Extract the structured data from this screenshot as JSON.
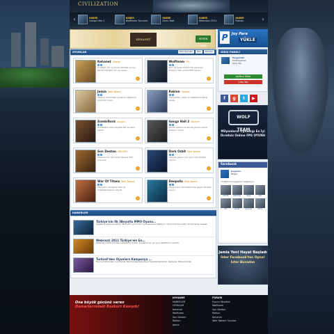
{
  "header": {
    "logo": "CIVILIZATION",
    "strip": [
      {
        "tag": "HABER",
        "text": "Gangz Hali 2"
      },
      {
        "tag": "HABER",
        "text": "Wolfteam Turnuva"
      },
      {
        "tag": "HABER",
        "text": "Zorlu Bati"
      },
      {
        "tag": "HABER",
        "text": "Webrazzi 2011"
      },
      {
        "tag": "HABER",
        "text": "Rakion"
      }
    ]
  },
  "banner": {
    "center": "KEHANET",
    "button": "HEMEN OYNA"
  },
  "games_section": {
    "title": "OYUNLAR",
    "tabs": [
      "Tüm Oyunlar",
      "Yeni",
      "Popüler"
    ]
  },
  "games": [
    {
      "title": "Kehanet",
      "genre": "Strateji",
      "desc": "Ücretsiz çok oyunculu strateji oyunu. Kendi krallığını kur ve savaş.",
      "color1": "#c9a25a",
      "color2": "#6b4a22"
    },
    {
      "title": "Wolfteam",
      "genre": "FPS",
      "desc": "Kurt ve insan formunda oynanan aksiyon dolu online FPS oyunu.",
      "color1": "#3a4a5c",
      "color2": "#121a24"
    },
    {
      "title": "Jamia",
      "genre": "Web Tabanlı",
      "desc": "Tarayıcı üzerinden oynanan eğlenceli çevrimiçi oyun.",
      "color1": "#d9c8a0",
      "color2": "#8a6a3c"
    },
    {
      "title": "Rakion",
      "genre": "Aksiyon",
      "desc": "Canavarları çağır ve rakiplerine karşı savaş.",
      "color1": "#8aa0c0",
      "color2": "#2a3a58"
    },
    {
      "title": "ZombiRock",
      "genre": "Aksiyon",
      "desc": "Zombilere karşı hayatta kal ve şehri kurtar.",
      "color1": "#7a5030",
      "color2": "#2a1a10"
    },
    {
      "title": "Gangz Hali 2",
      "genre": "Aksiyon",
      "desc": "Sokak çeteleri arasında geçen online aksiyon oyunu.",
      "color1": "#5a5a5a",
      "color2": "#1c1c1c"
    },
    {
      "title": "Son Destan",
      "genre": "MMORPG",
      "desc": "Efsanevi bir dünyada macera dolu yolculuk.",
      "color1": "#a06830",
      "color2": "#3a2410"
    },
    {
      "title": "Dark Orbit",
      "genre": "Web Tabanlı",
      "desc": "Uzayda geçen çok oyunculu strateji oyunu.",
      "color1": "#2a4a7a",
      "color2": "#0a1428"
    },
    {
      "title": "War Of Titans",
      "genre": "Web Tabanlı",
      "desc": "Titanların savaşına katıl ve imparatorluğunu büyüt.",
      "color1": "#c07040",
      "color2": "#4a2010"
    },
    {
      "title": "Deepolis",
      "genre": "Web Tabanlı",
      "desc": "Okyanusun derinliklerinde geçen strateji oyunu.",
      "color1": "#2a7aa0",
      "color2": "#0a2a40"
    }
  ],
  "news_section": {
    "title": "HABERLER"
  },
  "news": [
    {
      "title": "Türkiye'nin İlk 3Boyutlu MMO Oyunu...",
      "text": "Joygame yayınına aldığı 3Boyutlu oyun tüm oyunseverleri bekliyor. Oyuna hemen katıl ve macerayı başlat.",
      "color1": "#3a6a9a",
      "color2": "#0c2238"
    },
    {
      "title": "Webrazzi 2011 Türkiye'nin En...",
      "text": "Webrazzi 2011 ödülleri sahiplerini buldu. Joygame en iyi oyun platformu seçildi.",
      "color1": "#d08a20",
      "color2": "#6a3a08"
    },
    {
      "title": "Turkcell'den Oyunlara Kampanya ...",
      "text": "Turkcell aboneleri oyunlarda özel kampanyalardan faydalanabilecek. Detaylar haberimizde.",
      "color1": "#7a5aa0",
      "color2": "#2a1a40"
    }
  ],
  "sidebar": {
    "joypara_small": "Joy Para",
    "joypara_big": "YÜKLE",
    "login_title": "GİRİŞ PANELİ",
    "user_line1": "Hoşgeldin",
    "user_line2": "Profil Ayarları",
    "user_line3": "Çıkış Yap",
    "btn_green": "JoyPara Yükle",
    "btn_red": "Çıkış Yap",
    "wolf_logo": "WOLF TEAM",
    "wolf_text": "Milyonların Oynadığı En İyi Ücretsiz Online FPS OYUNU",
    "fb_title": "facebook",
    "fb_page": "Joygame",
    "fb_like": "Beğen",
    "fb_count": "73.599 kişi Joygame'i beğeniyor.",
    "fb_names": [
      "Ahmet",
      "Mehmet",
      "Ayşe",
      "Can",
      "Elif",
      "Burak",
      "Zeynep",
      "Emre"
    ],
    "promo1": "Jamia Yeni Hayat Başladı",
    "promo2": "İster Facebook'tan Oyna! İster Buradan"
  },
  "footer": {
    "slogan1": "Ona büyük gücünü veren",
    "slogan2": "Damarlarındaki Bozkurt Kanıydı!",
    "col1_head": "JOYGAME",
    "col1": [
      "HABERLER",
      "OYUNLAR",
      "Kehanet",
      "Wolfteam",
      "Son Destan",
      "Rakion",
      "Jamia"
    ],
    "col2_head": "FORUM",
    "col2": [
      "Forum Yönetimi",
      "Wolfteam",
      "Son Destan",
      "Rakion",
      "Kehanet",
      "Web Tabanlı Oyunlar"
    ]
  },
  "colors": {
    "accent": "#1d4a80",
    "genre": "#d08a00",
    "go": "#f0a020"
  }
}
